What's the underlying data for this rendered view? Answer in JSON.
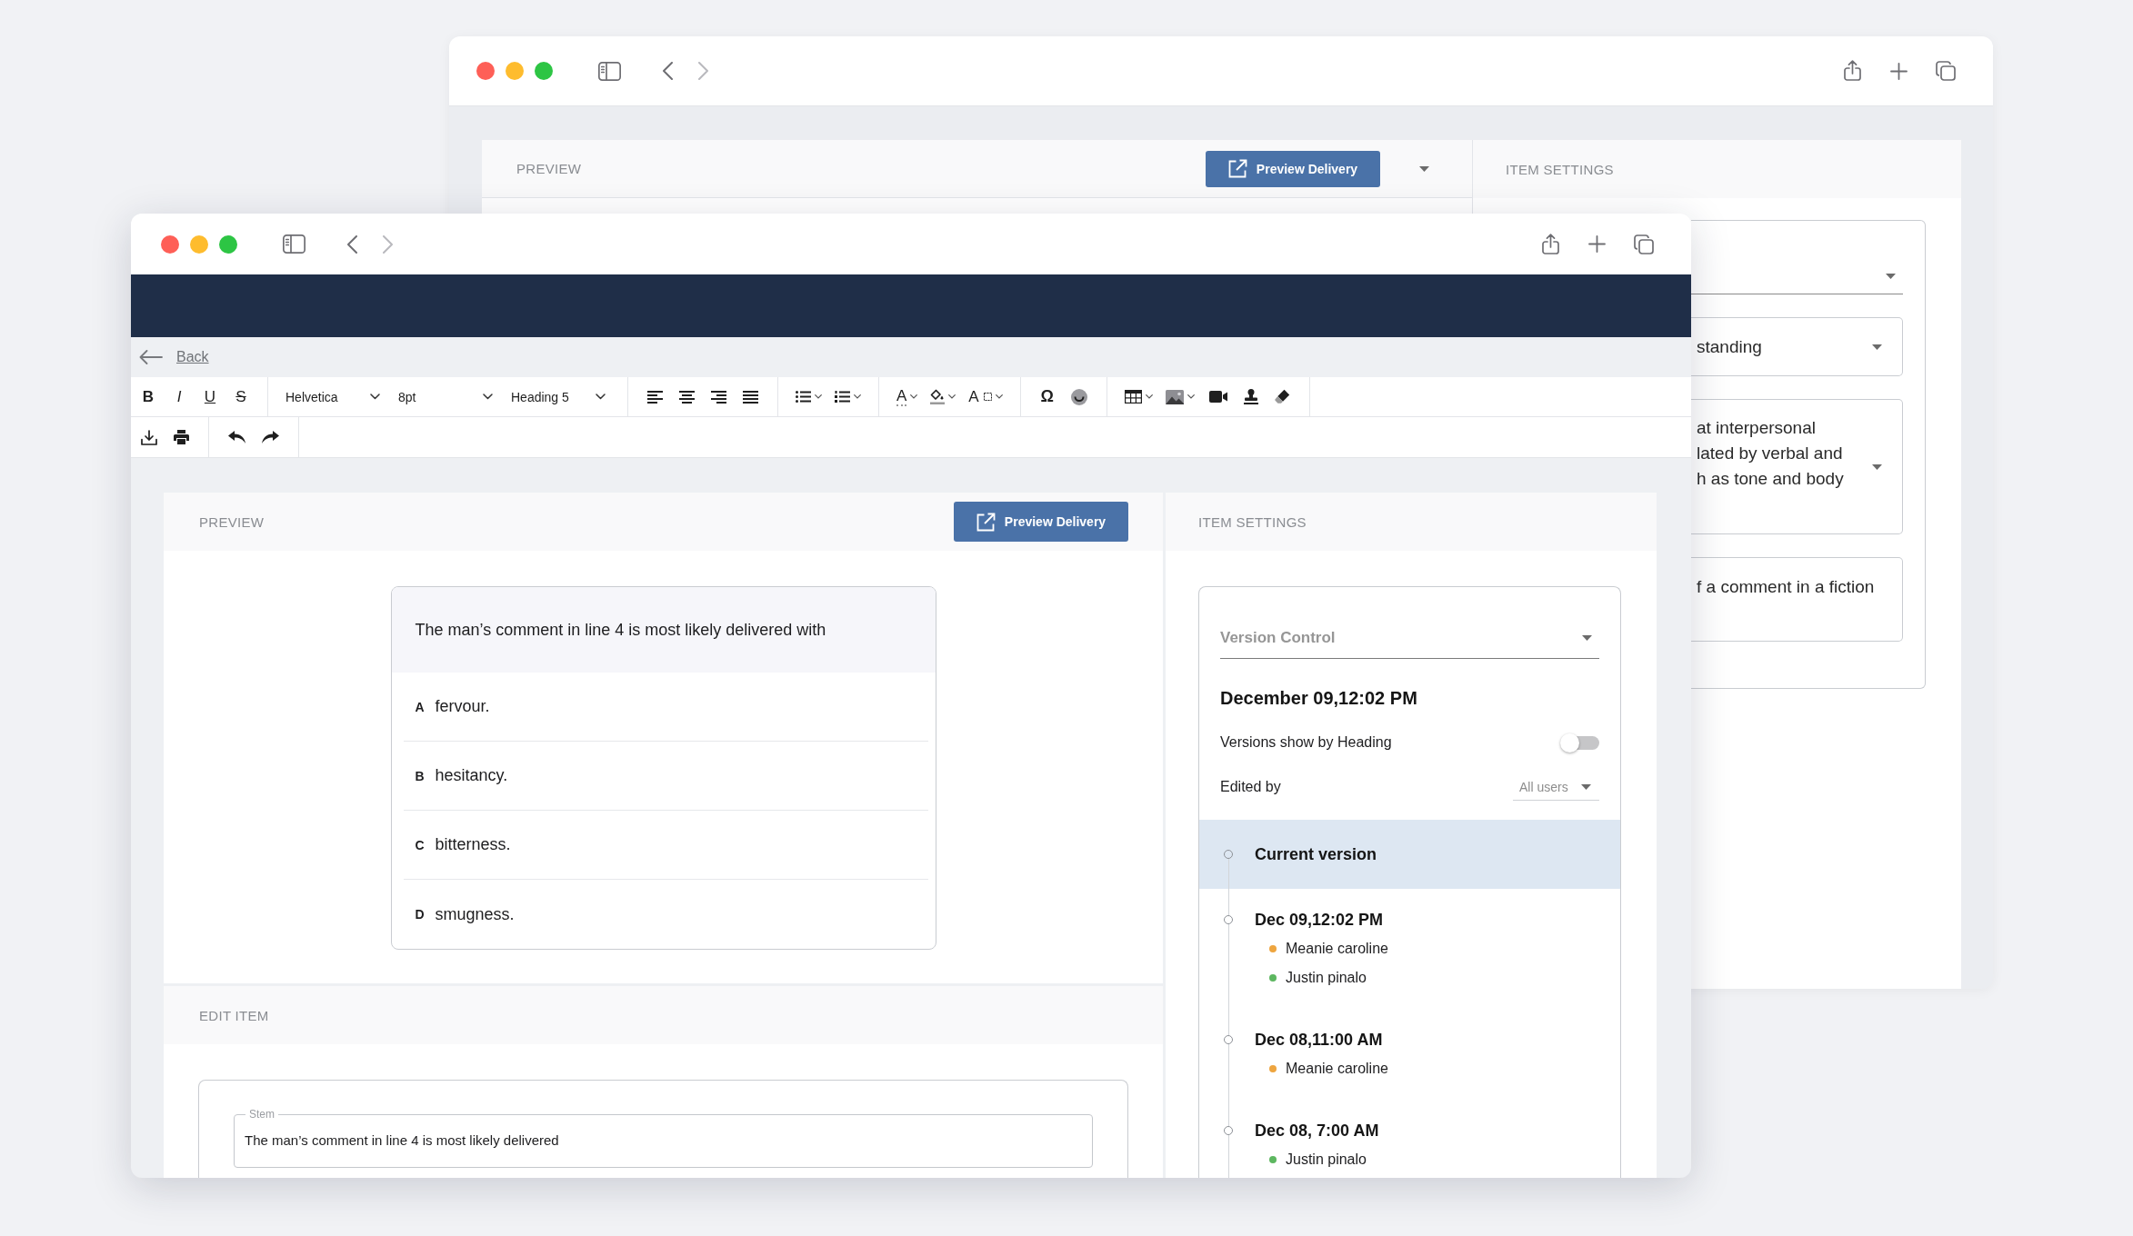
{
  "back_window": {
    "nav": {
      "forward_disabled": true
    },
    "preview": {
      "title": "PREVIEW",
      "button": "Preview Delivery"
    },
    "item_settings": {
      "title": "ITEM SETTINGS",
      "fields": [
        {
          "kind": "select"
        },
        {
          "kind": "dropdown",
          "lines": [
            "standing"
          ]
        },
        {
          "kind": "dropdown",
          "lines": [
            "at interpersonal",
            "lated by verbal and",
            "h as tone and body"
          ]
        },
        {
          "kind": "textarea",
          "lines": [
            "f a comment in a fiction"
          ]
        }
      ]
    }
  },
  "front_window": {
    "nav": {
      "forward_disabled": true
    },
    "back_link": "Back",
    "toolbar": {
      "rows": [
        [
          [
            {
              "kind": "bold",
              "label": "B"
            },
            {
              "kind": "italic",
              "label": "I"
            },
            {
              "kind": "underline",
              "label": "U"
            },
            {
              "kind": "strike",
              "label": "S"
            }
          ],
          [
            {
              "kind": "family",
              "value": "Helvetica"
            },
            {
              "kind": "size",
              "value": "8pt"
            },
            {
              "kind": "format",
              "value": "Heading 5"
            }
          ],
          [
            {
              "kind": "alignleft"
            },
            {
              "kind": "aligncenter"
            },
            {
              "kind": "alignright"
            },
            {
              "kind": "justify"
            }
          ],
          [
            {
              "kind": "bullets"
            },
            {
              "kind": "numbers"
            }
          ],
          [
            {
              "kind": "textcolor",
              "label": "A"
            },
            {
              "kind": "highlight"
            },
            {
              "kind": "textsize",
              "label": "A"
            }
          ],
          [
            {
              "kind": "symbol",
              "label": "Ω"
            },
            {
              "kind": "emoji"
            }
          ],
          [
            {
              "kind": "table"
            },
            {
              "kind": "image"
            },
            {
              "kind": "video"
            },
            {
              "kind": "stamp"
            },
            {
              "kind": "eraser"
            }
          ]
        ],
        [
          [
            {
              "kind": "download"
            },
            {
              "kind": "print"
            }
          ],
          [
            {
              "kind": "undo"
            },
            {
              "kind": "redo"
            }
          ]
        ]
      ]
    },
    "preview": {
      "title": "PREVIEW",
      "button": "Preview Delivery",
      "question": {
        "stem": "The man’s comment in line 4 is most likely delivered with",
        "options": [
          {
            "letter": "A",
            "text": "fervour."
          },
          {
            "letter": "B",
            "text": "hesitancy."
          },
          {
            "letter": "C",
            "text": "bitterness."
          },
          {
            "letter": "D",
            "text": "smugness."
          }
        ]
      }
    },
    "edit_item": {
      "title": "EDIT ITEM",
      "stem_field": {
        "label": "Stem",
        "value": "The man’s comment in line 4 is most likely delivered"
      }
    },
    "item_settings": {
      "title": "ITEM SETTINGS",
      "version_select": {
        "label": "Version Control"
      },
      "heading": "December 09,12:02 PM",
      "toggle": {
        "label": "Versions show by Heading",
        "on": false
      },
      "edited_by": {
        "label": "Edited by",
        "value": "All users"
      },
      "versions": [
        {
          "title": "Current version",
          "selected": true
        },
        {
          "title": "Dec 09,12:02 PM",
          "selected": false,
          "editors": [
            {
              "name": "Meanie caroline",
              "color": "#eea53f"
            },
            {
              "name": "Justin pinalo",
              "color": "#5db760"
            }
          ]
        },
        {
          "title": "Dec 08,11:00 AM",
          "selected": false,
          "editors": [
            {
              "name": "Meanie caroline",
              "color": "#eea53f"
            }
          ]
        },
        {
          "title": "Dec 08, 7:00 AM",
          "selected": false,
          "editors": [
            {
              "name": "Justin pinalo",
              "color": "#5db760"
            }
          ]
        }
      ]
    }
  }
}
